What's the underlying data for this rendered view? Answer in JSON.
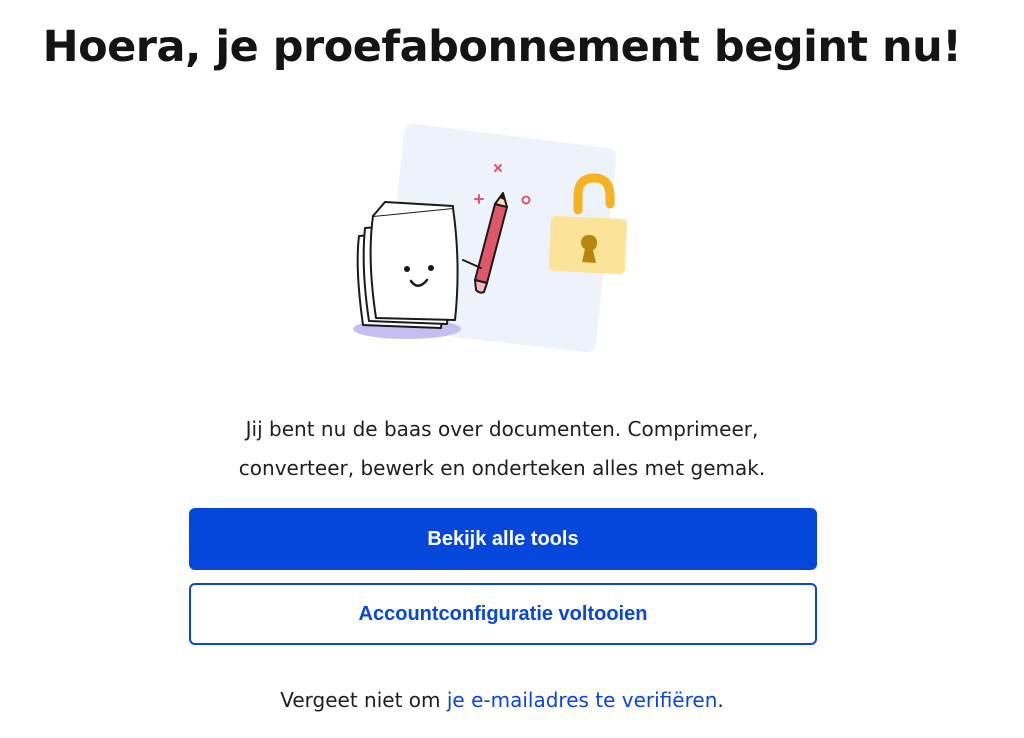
{
  "header": {
    "title": "Hoera, je proefabonnement begint nu!"
  },
  "illustration": {
    "icons": [
      "document-character-icon",
      "pencil-icon",
      "unlocked-padlock-icon"
    ]
  },
  "main": {
    "description": "Jij bent nu de baas over documenten. Comprimeer, converteer, bewerk en onderteken alles met gemak."
  },
  "actions": {
    "primary_label": "Bekijk alle tools",
    "secondary_label": "Accountconfiguratie voltooien"
  },
  "footer": {
    "prefix": "Vergeet niet om ",
    "link": "je e-mailadres te verifiëren",
    "suffix": "."
  },
  "colors": {
    "primary": "#0547db",
    "link": "#0a47d6",
    "illustration_bg": "#eef2fb",
    "lock": "#f5b324",
    "pencil": "#e0566b",
    "shadow": "#c8bdf0"
  }
}
